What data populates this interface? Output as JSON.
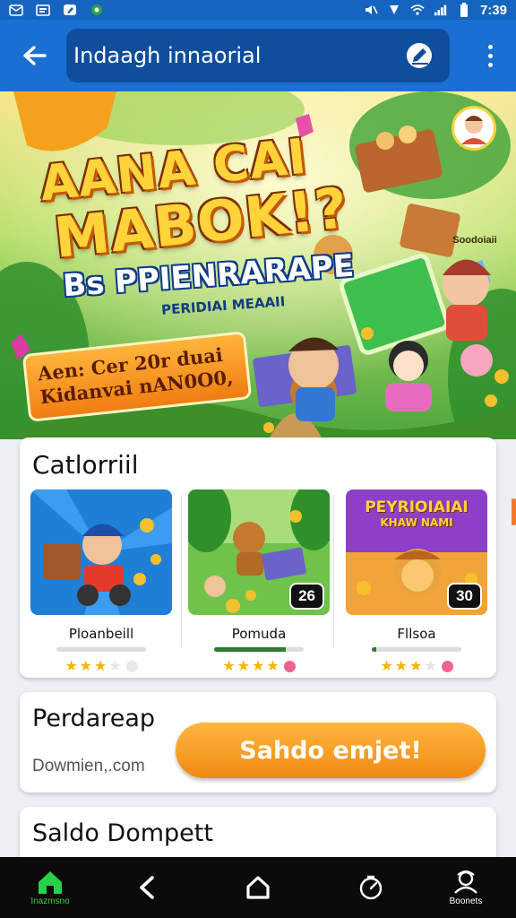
{
  "status_bar": {
    "time": "7:39",
    "left_icons": [
      "mail-icon",
      "message-icon",
      "pen-icon",
      "app-icon"
    ],
    "right_icons": [
      "mute-icon",
      "do-not-disturb-icon",
      "wifi-icon",
      "signal-icon",
      "battery-icon"
    ]
  },
  "toolbar": {
    "title": "Indaagh innaorial",
    "back_icon": "arrow-left-icon",
    "edit_icon": "pen-icon",
    "menu_icon": "more-vert-icon"
  },
  "banner": {
    "headline_line1": "AANA CAI",
    "headline_line2": "MABOK!?",
    "subtitle": "Bs PPIENRARAPE",
    "subtitle_small": "PERIDIAI MEAAII",
    "promo_line1": "Aen: Cer 20r duai",
    "promo_line2": "Kidanvai nAN0O0,",
    "profile_name": "Soodoiaii"
  },
  "categories": {
    "title": "Catlorriil",
    "games": [
      {
        "name": "Ploanbeill",
        "badge": "",
        "progress": 0.0,
        "stars": 3,
        "dot_color": "#e9e9e9"
      },
      {
        "name": "Pomuda",
        "badge": "26",
        "progress": 0.8,
        "stars": 4,
        "dot_color": "#f06292"
      },
      {
        "name": "Fllsoa",
        "badge": "30",
        "progress": 0.05,
        "stars": 3,
        "dot_color": "#f06292"
      }
    ],
    "game3_thumb_title_1": "PEYRIOIAIAI",
    "game3_thumb_title_2": "KHAW NAMI"
  },
  "wallet": {
    "title": "Perdareap",
    "domain": "Dowmien,.com",
    "button_label": "Sahdo emjet!"
  },
  "saldo": {
    "title": "Saldo Dompett"
  },
  "bottom_nav": [
    {
      "label": "Inazmsno",
      "icon": "home-icon",
      "active": true
    },
    {
      "label": "",
      "icon": "back-icon",
      "active": false
    },
    {
      "label": "",
      "icon": "home-outline-icon",
      "active": false
    },
    {
      "label": "",
      "icon": "timer-icon",
      "active": false
    },
    {
      "label": "Boonets",
      "icon": "profile-icon",
      "active": false
    }
  ],
  "colors": {
    "toolbar": "#1a6fd3",
    "search_pill": "#0f4e9c",
    "accent_orange": "#f08a12",
    "active_nav": "#28d14a"
  }
}
